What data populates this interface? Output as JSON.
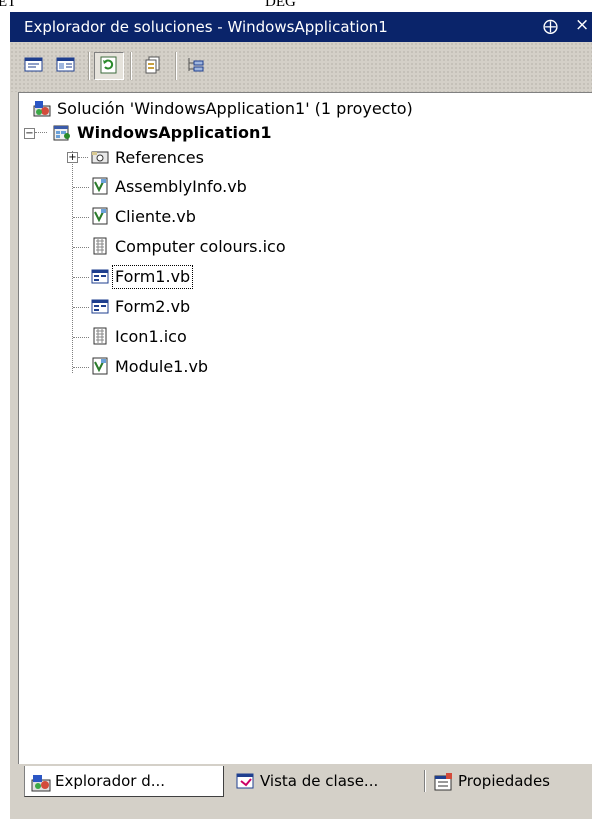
{
  "header": {
    "left_fragment": "ET",
    "center_fragment": "DEG"
  },
  "window": {
    "title": "Explorador de soluciones - WindowsApplication1",
    "pin_glyph": "⨁",
    "close_glyph": "×"
  },
  "toolbar": {
    "buttons": [
      "properties-icon",
      "view-designer-icon",
      "refresh-icon",
      "show-all-files-icon",
      "view-class-diagram-icon"
    ]
  },
  "tree": {
    "solution": "Solución 'WindowsApplication1' (1 proyecto)",
    "project": "WindowsApplication1",
    "items": [
      {
        "label": "References",
        "icon": "references-icon",
        "expandable": true
      },
      {
        "label": "AssemblyInfo.vb",
        "icon": "vb-file-icon"
      },
      {
        "label": "Cliente.vb",
        "icon": "vb-file-icon"
      },
      {
        "label": "Computer colours.ico",
        "icon": "ico-file-icon"
      },
      {
        "label": "Form1.vb",
        "icon": "form-icon",
        "selected": true
      },
      {
        "label": "Form2.vb",
        "icon": "form-icon"
      },
      {
        "label": "Icon1.ico",
        "icon": "ico-file-icon"
      },
      {
        "label": "Module1.vb",
        "icon": "vb-file-icon"
      }
    ]
  },
  "tabs": [
    {
      "label": "Explorador d...",
      "icon": "solution-explorer-icon",
      "active": true
    },
    {
      "label": "Vista de clase...",
      "icon": "class-view-icon"
    },
    {
      "label": "Propiedades",
      "icon": "properties-window-icon"
    }
  ],
  "colors": {
    "titlebar": "#0a246a",
    "panel": "#d4d0c8",
    "tree_bg": "#ffffff"
  }
}
